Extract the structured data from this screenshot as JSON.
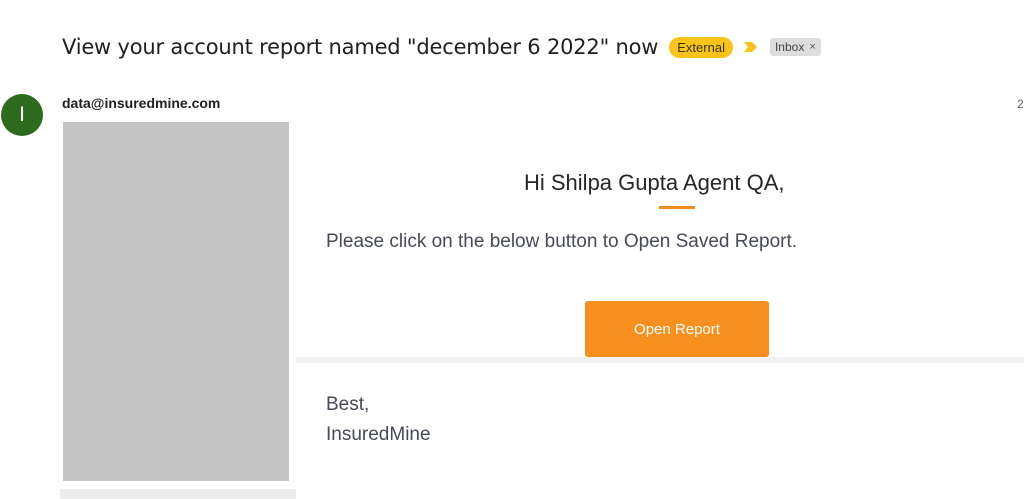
{
  "header": {
    "subject": "View your account report named \"december 6 2022\" now",
    "external_badge": "External",
    "importance_icon": "importance-marker-icon",
    "label": "Inbox",
    "label_remove": "×",
    "colors": {
      "external_bg": "#f9c41a",
      "importance": "#f9c41a"
    }
  },
  "message": {
    "avatar_letter": "I",
    "avatar_color": "#2d6b1f",
    "sender": "data@insuredmine.com",
    "date_partial": "2",
    "body": {
      "greeting": "Hi Shilpa Gupta Agent QA,",
      "instruction": "Please click on the below button to Open Saved Report.",
      "button_label": "Open Report",
      "signoff_line1": "Best,",
      "signoff_line2": "InsuredMine",
      "accent_color": "#f7901e"
    }
  }
}
